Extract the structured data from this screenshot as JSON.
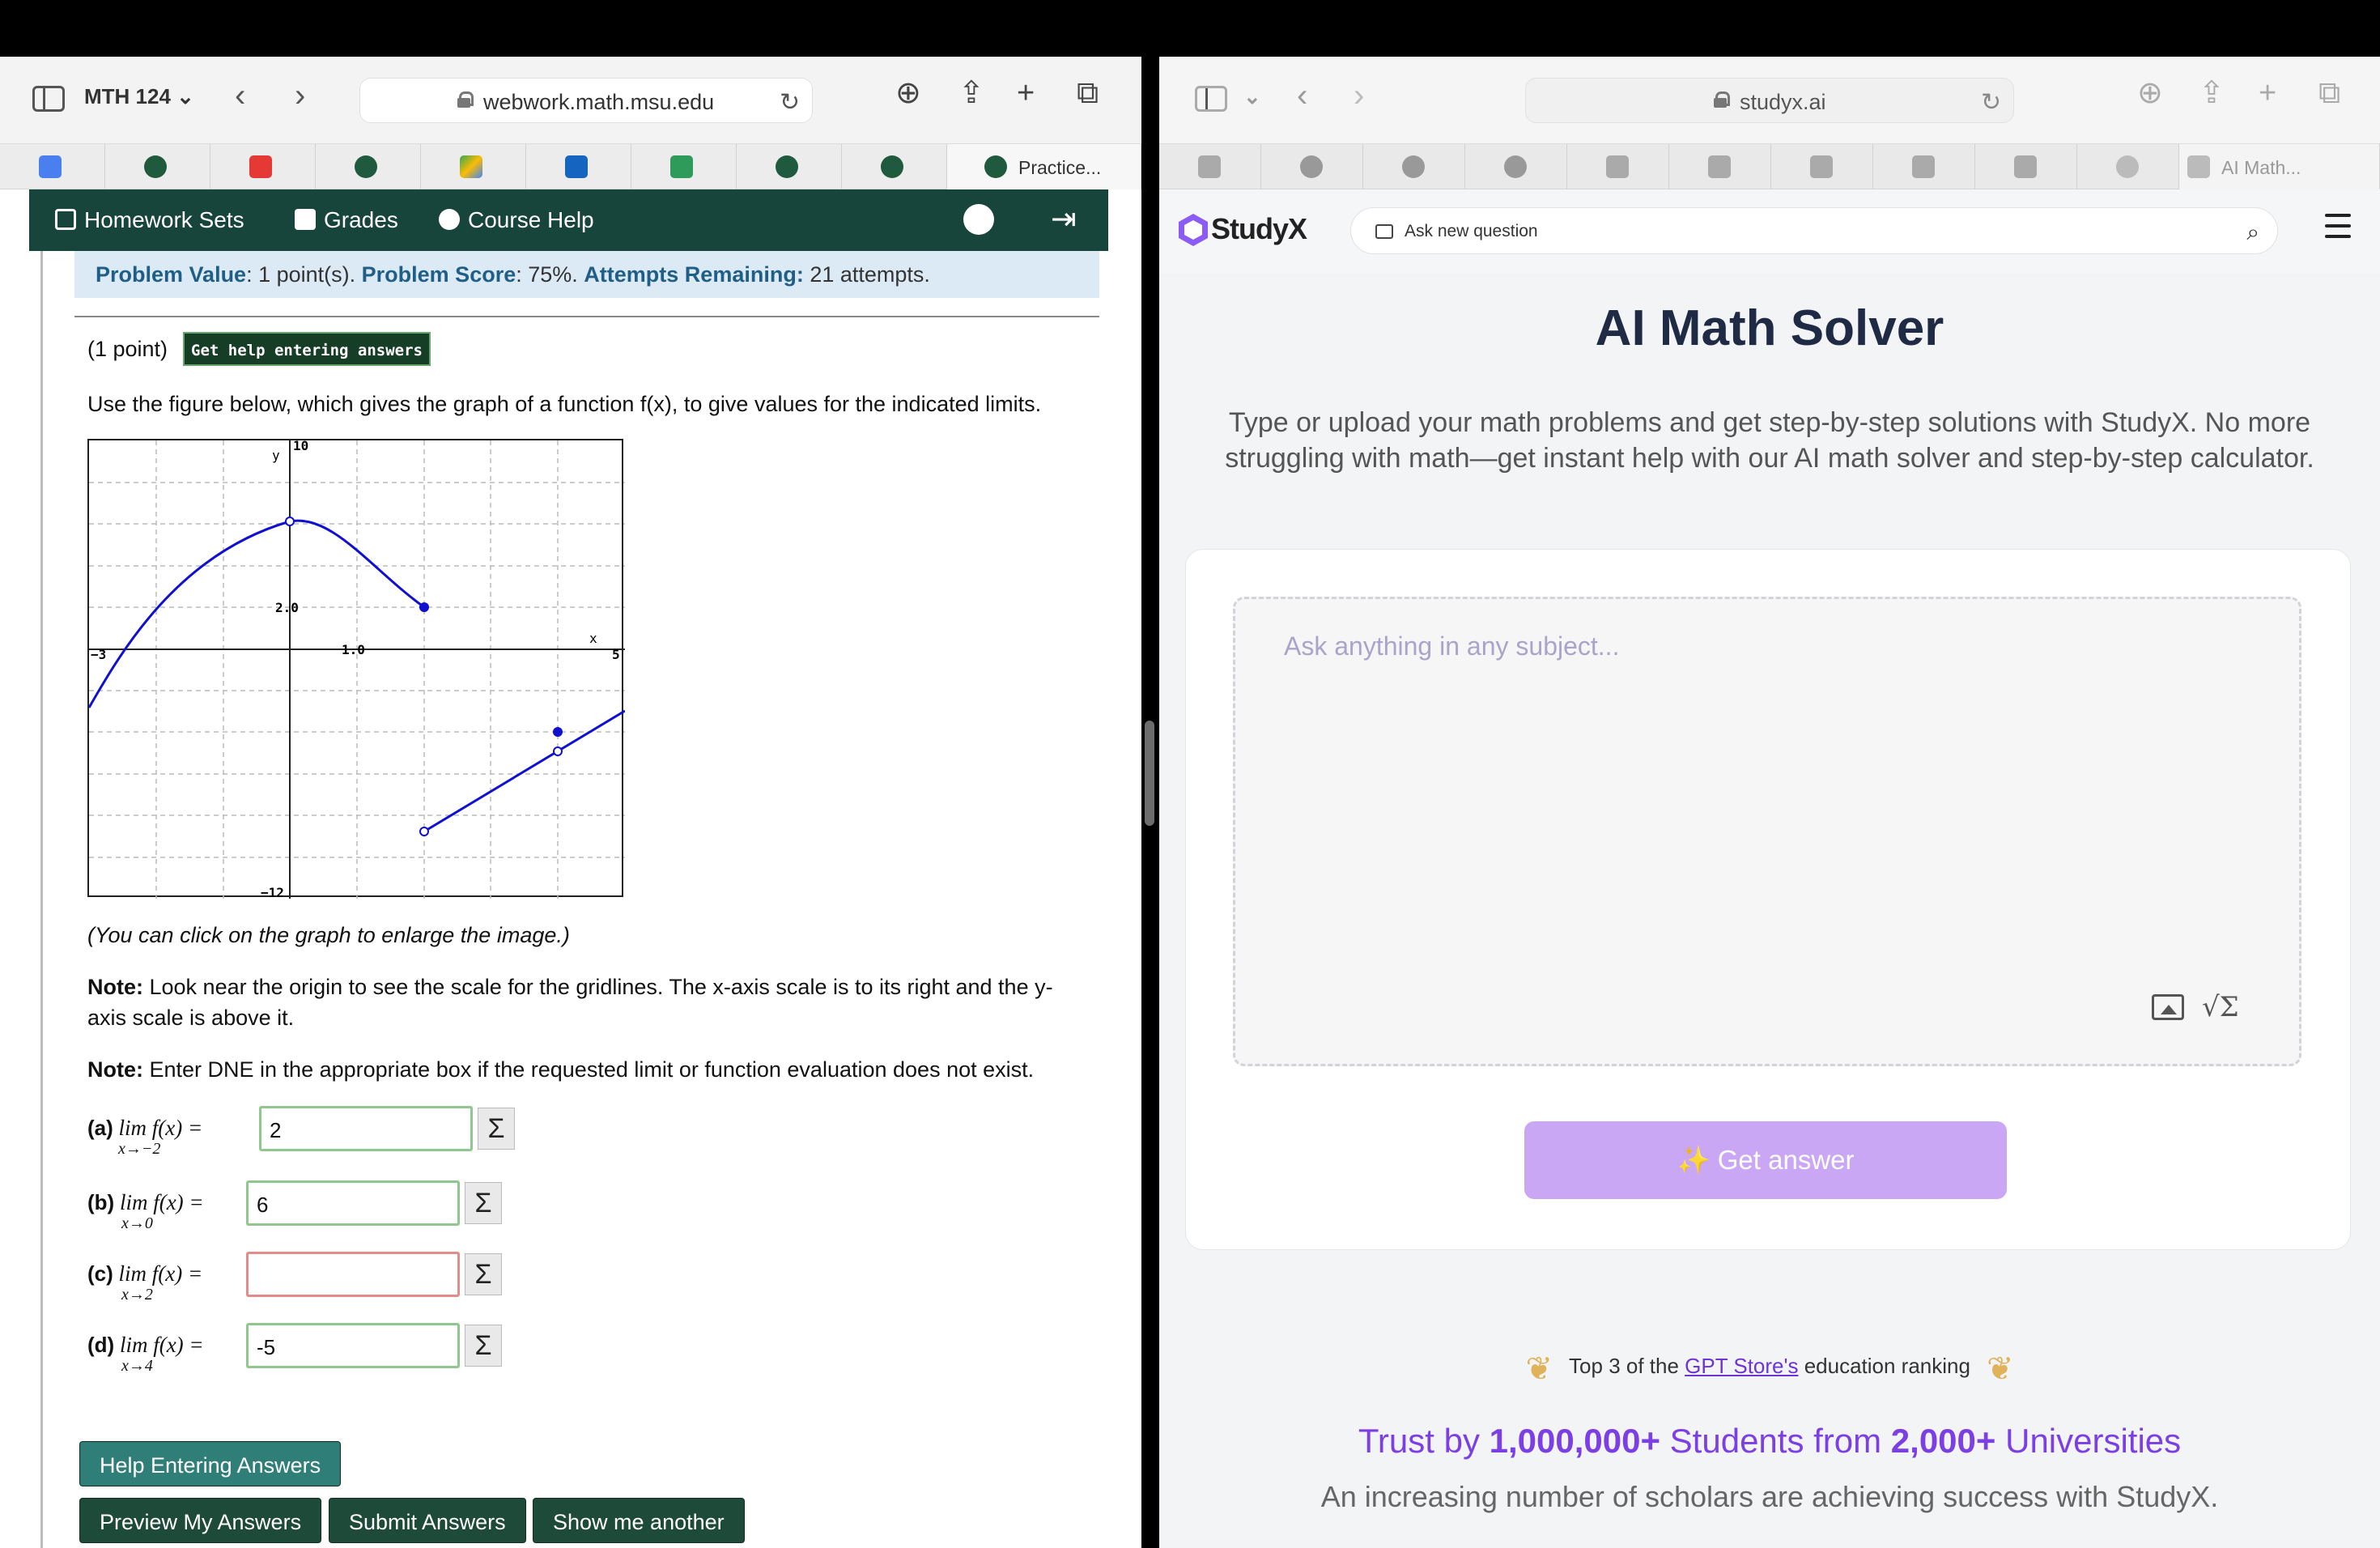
{
  "left_browser": {
    "tab_group": "MTH 124",
    "url": "webwork.math.msu.edu",
    "favorites": [
      {
        "icon": "docs-icon",
        "label": ""
      },
      {
        "icon": "spartan-icon",
        "label": ""
      },
      {
        "icon": "youtube-icon",
        "label": ""
      },
      {
        "icon": "spartan-icon",
        "label": ""
      },
      {
        "icon": "drive-icon",
        "label": ""
      },
      {
        "icon": "outlook-icon",
        "label": ""
      },
      {
        "icon": "check-icon",
        "label": ""
      },
      {
        "icon": "spartan-icon",
        "label": ""
      },
      {
        "icon": "spartan-icon",
        "label": ""
      },
      {
        "icon": "spartan-icon",
        "label": "Practice..."
      }
    ]
  },
  "webwork": {
    "nav": {
      "homework_sets": "Homework Sets",
      "grades": "Grades",
      "course_help": "Course Help"
    },
    "problem_value_label": "Problem Value",
    "problem_value": ": 1 point(s).",
    "problem_score_label": "Problem Score",
    "problem_score": ": 75%.",
    "attempts_label": "Attempts Remaining:",
    "attempts": " 21 attempts.",
    "points": "(1 point)",
    "help_badge": "Get help entering answers",
    "prompt": "Use the figure below, which gives the graph of a function f(x), to give values for the indicated limits.",
    "graph": {
      "y_label": "y",
      "x_label": "x",
      "y_top": "10",
      "y_bottom": "−12",
      "x_left": "−3",
      "x_right": "5",
      "y_scale": "2.0",
      "x_scale": "1.0"
    },
    "click_note": "(You can click on the graph to enlarge the image.)",
    "note1_bold": "Note:",
    "note1_line1": " Look near the origin to see the scale for the gridlines. The x-axis scale is to its right and the y-",
    "note1_line2": "axis scale is above it.",
    "note2_bold": "Note:",
    "note2": " Enter DNE in the appropriate box if the requested limit or function evaluation does not exist.",
    "answers": [
      {
        "letter": "(a)",
        "expr": "lim f(x) =",
        "sub": "x→−2",
        "value": "2",
        "state": "correct"
      },
      {
        "letter": "(b)",
        "expr": "lim f(x) =",
        "sub": "x→0",
        "value": "6",
        "state": "correct"
      },
      {
        "letter": "(c)",
        "expr": "lim f(x) =",
        "sub": "x→2",
        "value": "",
        "state": "incorrect"
      },
      {
        "letter": "(d)",
        "expr": "lim f(x) =",
        "sub": "x→4",
        "value": "-5",
        "state": "correct"
      }
    ],
    "sigma": "Σ",
    "buttons": {
      "help_entering": "Help Entering Answers",
      "preview": "Preview My Answers",
      "submit": "Submit Answers",
      "show_another": "Show me another"
    }
  },
  "right_browser": {
    "url": "studyx.ai",
    "last_tab": "AI Math..."
  },
  "studyx": {
    "logo": "StudyX",
    "ask_new": "Ask new question",
    "title": "AI Math Solver",
    "description": "Type or upload your math problems and get step-by-step solutions with StudyX. No more struggling with math—get instant help with our AI math solver and step-by-step calculator.",
    "placeholder": "Ask anything in any subject...",
    "math_button": "√Σ",
    "get_answer": "Get answer",
    "ranking_pre": "Top 3 of the ",
    "ranking_link": "GPT Store's",
    "ranking_post": " education ranking",
    "trust_1": "Trust by ",
    "trust_students": "1,000,000+",
    "trust_2": " Students from ",
    "trust_unis": "2,000+",
    "trust_3": " Universities",
    "increasing": "An increasing number of scholars are achieving success with StudyX."
  },
  "colors": {
    "webwork_green": "#18453b",
    "studyx_purple": "#7b3fe4",
    "get_answer_bg": "#c9a7f5"
  }
}
